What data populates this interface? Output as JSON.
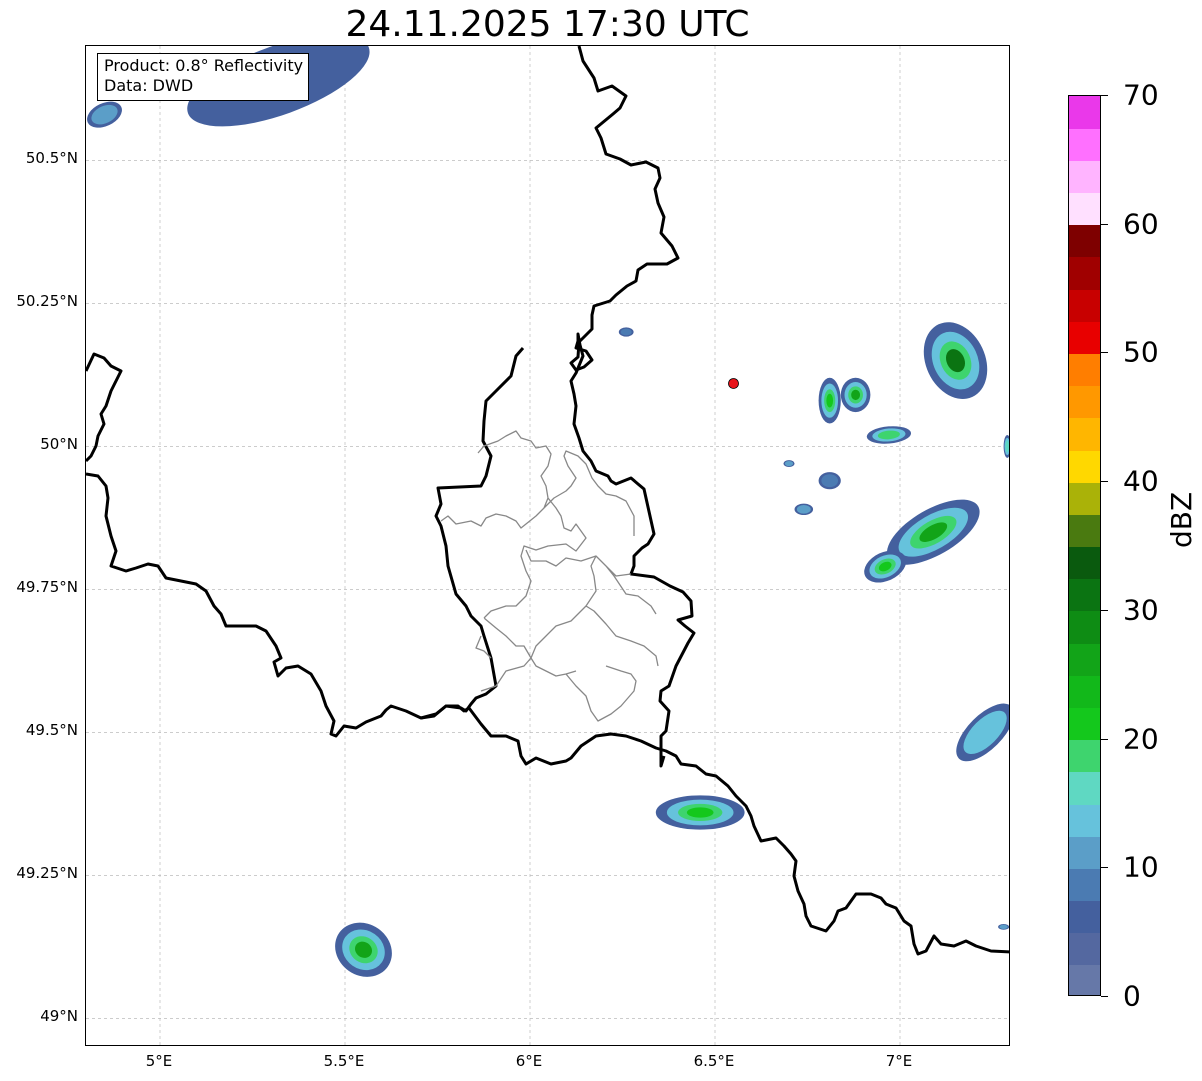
{
  "title": "24.11.2025 17:30 UTC",
  "info": {
    "product": "Product: 0.8° Reflectivity",
    "data": "Data: DWD"
  },
  "axes": {
    "lon_range": [
      4.8,
      7.3
    ],
    "lat_range": [
      48.95,
      50.7
    ],
    "x_ticks": [
      {
        "value": 5.0,
        "label": "5°E"
      },
      {
        "value": 5.5,
        "label": "5.5°E"
      },
      {
        "value": 6.0,
        "label": "6°E"
      },
      {
        "value": 6.5,
        "label": "6.5°E"
      },
      {
        "value": 7.0,
        "label": "7°E"
      }
    ],
    "y_ticks": [
      {
        "value": 49.0,
        "label": "49°N"
      },
      {
        "value": 49.25,
        "label": "49.25°N"
      },
      {
        "value": 49.5,
        "label": "49.5°N"
      },
      {
        "value": 49.75,
        "label": "49.75°N"
      },
      {
        "value": 50.0,
        "label": "50°N"
      },
      {
        "value": 50.25,
        "label": "50.25°N"
      },
      {
        "value": 50.5,
        "label": "50.5°N"
      }
    ],
    "grid": true
  },
  "radar_site": {
    "lon": 6.55,
    "lat": 50.11,
    "color": "#e8141a"
  },
  "colorbar": {
    "label": "dBZ",
    "ticks": [
      {
        "value": 0,
        "label": "0"
      },
      {
        "value": 10,
        "label": "10"
      },
      {
        "value": 20,
        "label": "20"
      },
      {
        "value": 30,
        "label": "30"
      },
      {
        "value": 40,
        "label": "40"
      },
      {
        "value": 50,
        "label": "50"
      },
      {
        "value": 60,
        "label": "60"
      },
      {
        "value": 70,
        "label": "70"
      }
    ],
    "range": [
      0,
      70
    ],
    "colors": [
      "#6678a8",
      "#5468a0",
      "#44609e",
      "#4b7bb2",
      "#5b9ec8",
      "#66c2dc",
      "#5fd8c2",
      "#3ed46e",
      "#14c81c",
      "#12b81a",
      "#12a418",
      "#0e8c14",
      "#0b7412",
      "#0a5a0e",
      "#4a7a10",
      "#aab208",
      "#ffd800",
      "#ffb600",
      "#ff9800",
      "#ff7e00",
      "#e80000",
      "#c80000",
      "#a00000",
      "#7e0000",
      "#ffe0ff",
      "#ffb4ff",
      "#ff70ff",
      "#ea38ea"
    ]
  },
  "reflectivity_cells": [
    {
      "lon": 5.32,
      "lat": 50.64,
      "rx": 0.26,
      "ry": 0.06,
      "rot": -20,
      "dbz": 5
    },
    {
      "lon": 4.85,
      "lat": 50.58,
      "rx": 0.05,
      "ry": 0.02,
      "rot": -25,
      "dbz": 12
    },
    {
      "lon": 6.26,
      "lat": 50.2,
      "rx": 0.02,
      "ry": 0.008,
      "rot": 0,
      "dbz": 8
    },
    {
      "lon": 6.81,
      "lat": 50.08,
      "rx": 0.03,
      "ry": 0.04,
      "rot": 0,
      "dbz": 22
    },
    {
      "lon": 6.88,
      "lat": 50.09,
      "rx": 0.04,
      "ry": 0.03,
      "rot": 0,
      "dbz": 26
    },
    {
      "lon": 6.97,
      "lat": 50.02,
      "rx": 0.06,
      "ry": 0.015,
      "rot": -5,
      "dbz": 18
    },
    {
      "lon": 7.15,
      "lat": 50.15,
      "rx": 0.08,
      "ry": 0.07,
      "rot": -25,
      "dbz": 30
    },
    {
      "lon": 7.29,
      "lat": 50.0,
      "rx": 0.01,
      "ry": 0.02,
      "rot": 0,
      "dbz": 15
    },
    {
      "lon": 6.81,
      "lat": 49.94,
      "rx": 0.03,
      "ry": 0.015,
      "rot": 0,
      "dbz": 8
    },
    {
      "lon": 6.74,
      "lat": 49.89,
      "rx": 0.025,
      "ry": 0.01,
      "rot": 0,
      "dbz": 10
    },
    {
      "lon": 6.7,
      "lat": 49.97,
      "rx": 0.015,
      "ry": 0.006,
      "rot": 0,
      "dbz": 12
    },
    {
      "lon": 7.09,
      "lat": 49.85,
      "rx": 0.14,
      "ry": 0.04,
      "rot": -30,
      "dbz": 26
    },
    {
      "lon": 6.96,
      "lat": 49.79,
      "rx": 0.06,
      "ry": 0.025,
      "rot": -25,
      "dbz": 22
    },
    {
      "lon": 7.23,
      "lat": 49.5,
      "rx": 0.1,
      "ry": 0.03,
      "rot": -45,
      "dbz": 14
    },
    {
      "lon": 6.46,
      "lat": 49.36,
      "rx": 0.12,
      "ry": 0.03,
      "rot": 0,
      "dbz": 22
    },
    {
      "lon": 5.55,
      "lat": 49.12,
      "rx": 0.08,
      "ry": 0.045,
      "rot": 35,
      "dbz": 26
    },
    {
      "lon": 7.28,
      "lat": 49.16,
      "rx": 0.015,
      "ry": 0.005,
      "rot": 0,
      "dbz": 12
    }
  ]
}
